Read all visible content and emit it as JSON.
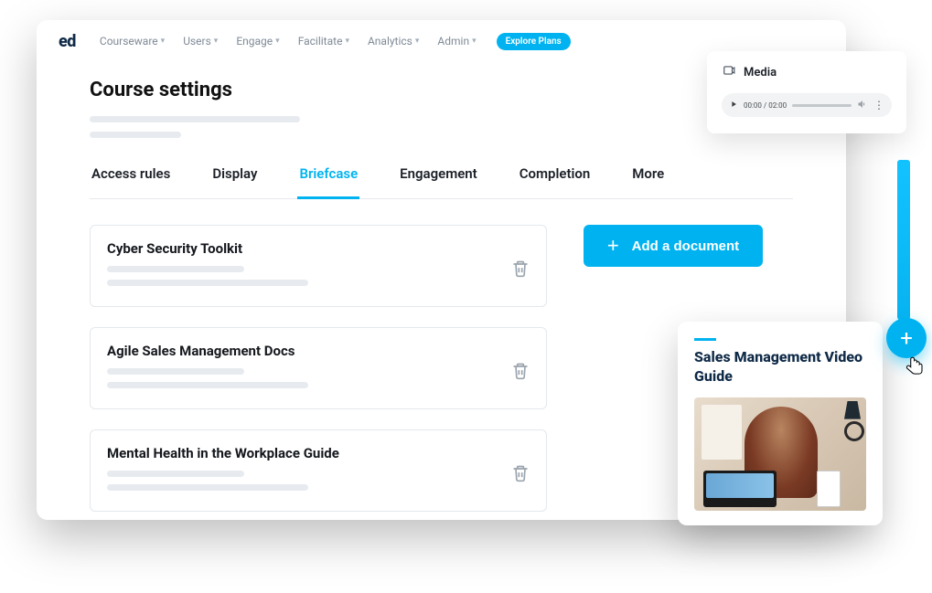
{
  "logo": "ed",
  "nav": [
    "Courseware",
    "Users",
    "Engage",
    "Facilitate",
    "Analytics",
    "Admin"
  ],
  "explore": "Explore Plans",
  "page_title": "Course settings",
  "tabs": [
    "Access rules",
    "Display",
    "Briefcase",
    "Engagement",
    "Completion",
    "More"
  ],
  "active_tab_index": 2,
  "documents": [
    {
      "title": "Cyber Security Toolkit"
    },
    {
      "title": "Agile Sales Management Docs"
    },
    {
      "title": "Mental Health in the Workplace Guide"
    }
  ],
  "add_button": "Add a document",
  "media": {
    "label": "Media",
    "time": "00:00 / 02:00"
  },
  "sales_card": {
    "title": "Sales Management Video Guide"
  }
}
